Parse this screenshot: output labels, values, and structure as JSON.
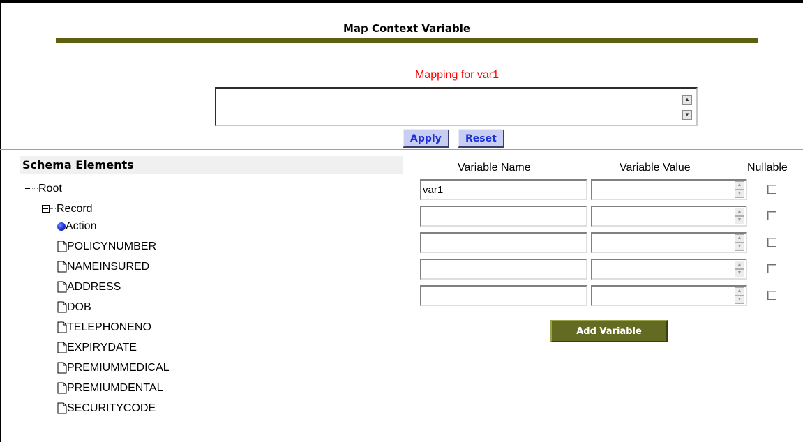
{
  "page": {
    "title": "Map Context Variable",
    "mapping_label": "Mapping for var1",
    "mapping_value": ""
  },
  "buttons": {
    "apply": "Apply",
    "reset": "Reset",
    "add_variable": "Add Variable"
  },
  "schema": {
    "header": "Schema Elements",
    "root": "Root",
    "record": "Record",
    "action": "Action",
    "fields": [
      "POLICYNUMBER",
      "NAMEINSURED",
      "ADDRESS",
      "DOB",
      "TELEPHONENO",
      "EXPIRYDATE",
      "PREMIUMMEDICAL",
      "PREMIUMDENTAL",
      "SECURITYCODE"
    ]
  },
  "variables": {
    "headers": {
      "name": "Variable Name",
      "value": "Variable Value",
      "nullable": "Nullable"
    },
    "rows": [
      {
        "name": "var1",
        "value": "",
        "nullable": false
      },
      {
        "name": "",
        "value": "",
        "nullable": false
      },
      {
        "name": "",
        "value": "",
        "nullable": false
      },
      {
        "name": "",
        "value": "",
        "nullable": false
      },
      {
        "name": "",
        "value": "",
        "nullable": false
      }
    ]
  },
  "colors": {
    "title_rule": "#5c6110",
    "mapping_label": "#ff0000",
    "button_text": "#1a2fd8",
    "add_button_bg": "#636b22"
  }
}
